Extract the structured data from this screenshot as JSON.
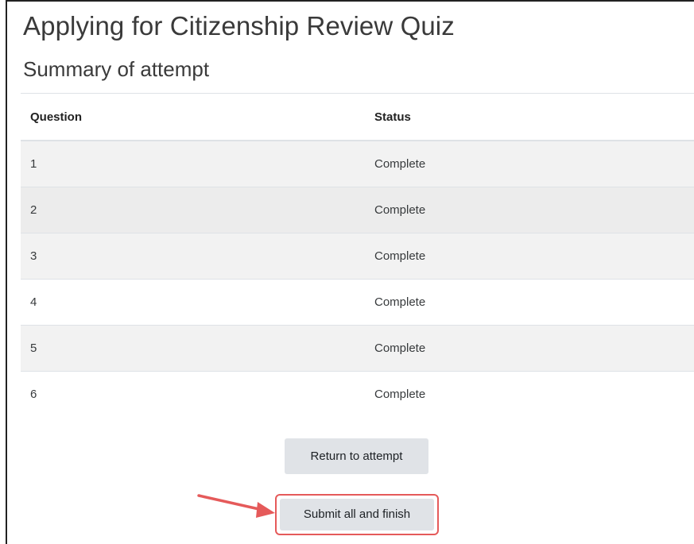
{
  "page": {
    "title": "Applying for Citizenship Review Quiz",
    "section_title": "Summary of attempt"
  },
  "table": {
    "headers": [
      "Question",
      "Status"
    ],
    "rows": [
      {
        "question": "1",
        "status": "Complete"
      },
      {
        "question": "2",
        "status": "Complete"
      },
      {
        "question": "3",
        "status": "Complete"
      },
      {
        "question": "4",
        "status": "Complete"
      },
      {
        "question": "5",
        "status": "Complete"
      },
      {
        "question": "6",
        "status": "Complete"
      }
    ]
  },
  "buttons": {
    "return_label": "Return to attempt",
    "submit_label": "Submit all and finish"
  },
  "colors": {
    "highlight": "#e55a5a",
    "button_bg": "#e0e3e7",
    "striped_row": "#f2f2f2"
  },
  "annotation": {
    "arrow_icon": "red-arrow-pointing-right"
  }
}
